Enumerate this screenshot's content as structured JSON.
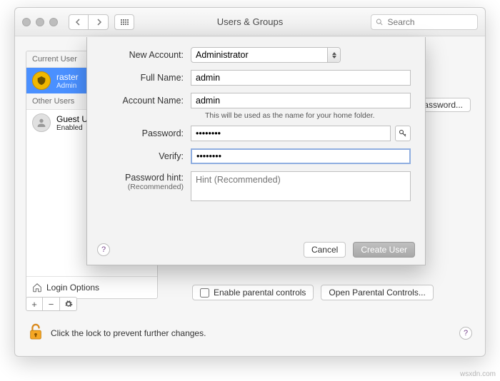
{
  "titlebar": {
    "title": "Users & Groups",
    "search_placeholder": "Search"
  },
  "sidebar": {
    "current_header": "Current User",
    "other_header": "Other Users",
    "users": [
      {
        "name": "raster",
        "role": "Admin",
        "selected": true
      },
      {
        "name": "Guest User",
        "role": "Enabled",
        "selected": false
      }
    ],
    "login_options": "Login Options"
  },
  "main": {
    "change_password": "Change Password...",
    "parental_check": "Enable parental controls",
    "open_parental": "Open Parental Controls..."
  },
  "lock": {
    "text": "Click the lock to prevent further changes."
  },
  "sheet": {
    "labels": {
      "new_account": "New Account:",
      "full_name": "Full Name:",
      "account_name": "Account Name:",
      "password": "Password:",
      "verify": "Verify:",
      "hint": "Password hint:",
      "hint_sub": "(Recommended)"
    },
    "values": {
      "account_type": "Administrator",
      "full_name": "admin",
      "account_name": "admin",
      "password": "••••••••",
      "verify": "••••••••"
    },
    "account_name_helper": "This will be used as the name for your home folder.",
    "hint_placeholder": "Hint (Recommended)",
    "buttons": {
      "cancel": "Cancel",
      "create": "Create User"
    }
  },
  "watermark": "wsxdn.com"
}
